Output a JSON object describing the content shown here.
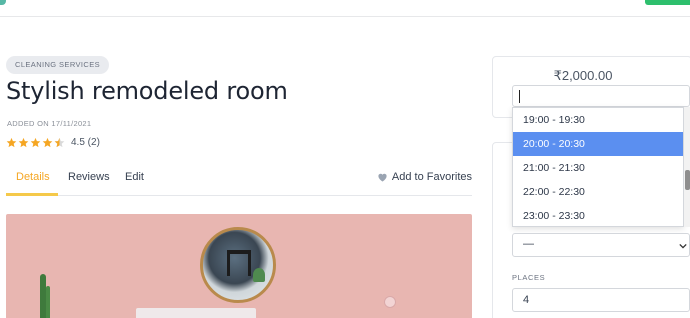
{
  "listing": {
    "category": "CLEANING SERVICES",
    "title": "Stylish remodeled room",
    "added": "ADDED ON 17/11/2021",
    "rating_value": 4.5,
    "rating_text": "4.5 (2)"
  },
  "tabs": [
    {
      "label": "Details",
      "active": true
    },
    {
      "label": "Reviews",
      "active": false
    },
    {
      "label": "Edit",
      "active": false
    }
  ],
  "favorites_label": "Add to Favorites",
  "booking": {
    "price": "₹2,000.00",
    "time_slots": [
      "19:00 - 19:30",
      "20:00 - 20:30",
      "21:00 - 21:30",
      "22:00 - 22:30",
      "23:00 - 23:30"
    ],
    "selected_slot": "20:00 - 20:30",
    "select_value": "—",
    "places_label": "PLACES",
    "places_value": "4"
  },
  "colors": {
    "accent": "#f5a623",
    "selected_option": "#5b8ff0",
    "star": "#f5a623",
    "hero_wall": "#e8b6b1"
  }
}
